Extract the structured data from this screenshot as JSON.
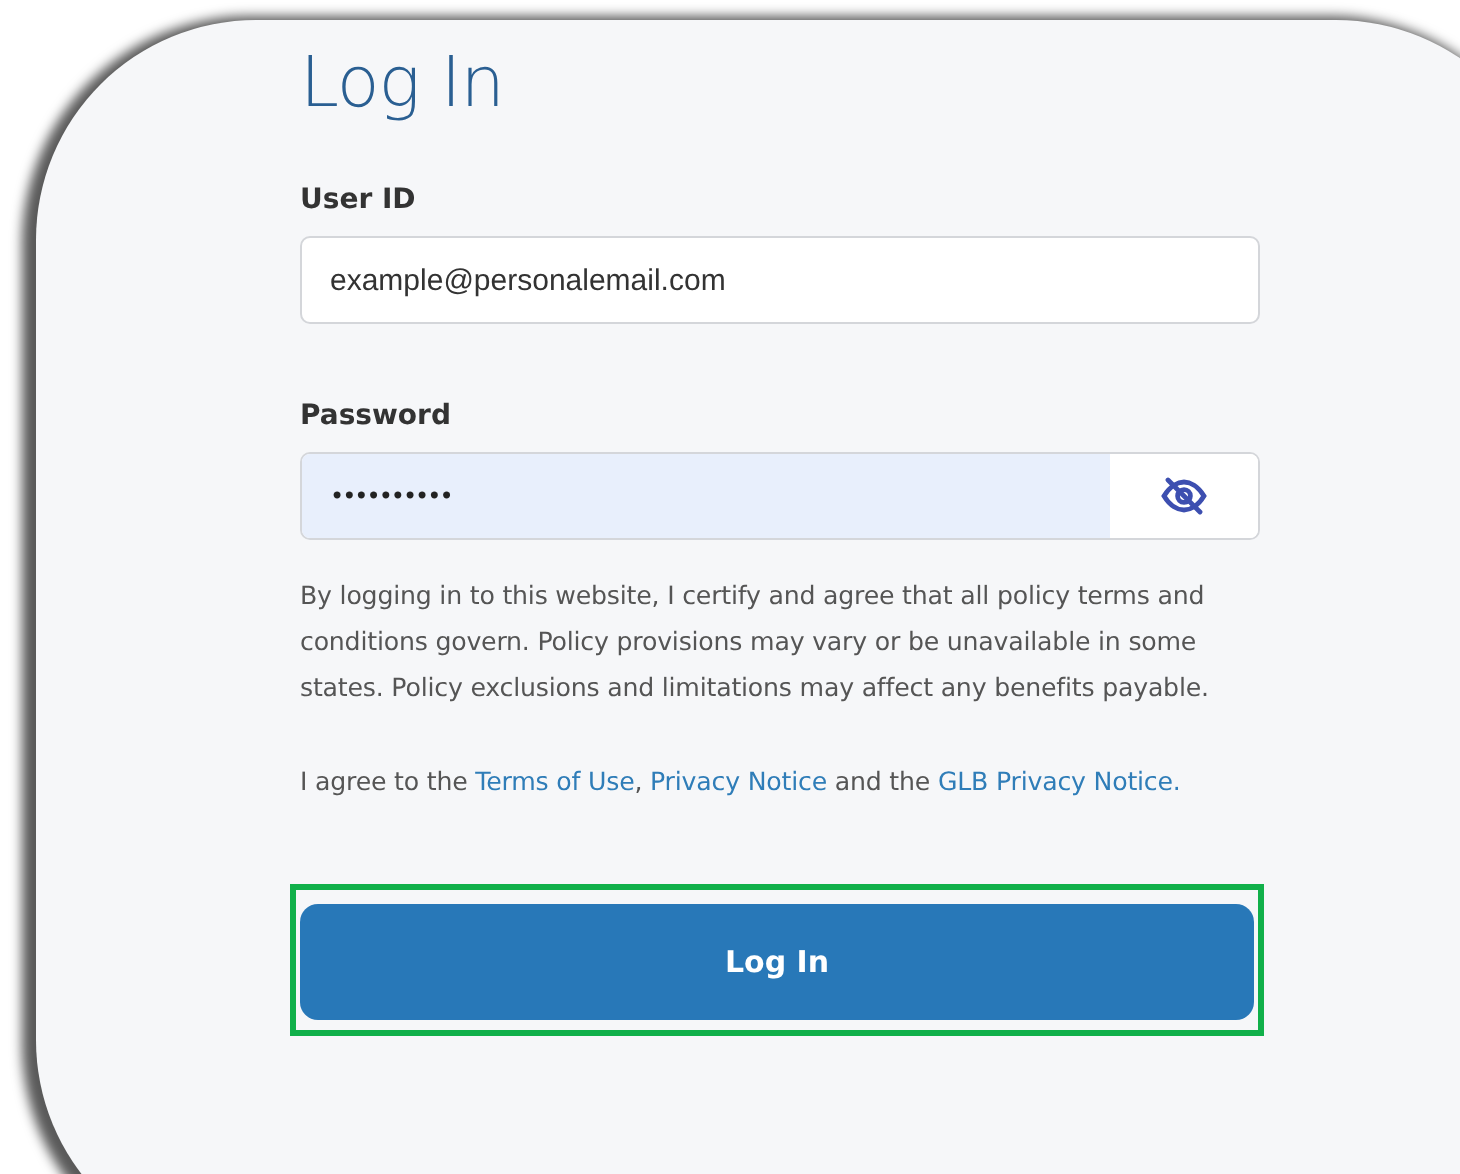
{
  "title": "Log In",
  "fields": [
    {
      "kind": "text",
      "label": "User ID",
      "value": "example@personalemail.com"
    },
    {
      "kind": "password",
      "label": "Password",
      "value": "••••••••••"
    }
  ],
  "disclaimer": "By logging in to this website, I certify and agree that all policy terms and conditions govern. Policy provisions may vary or be unavailable in some states. Policy exclusions and limitations may affect any benefits payable.",
  "agreement": [
    {
      "kind": "text",
      "text": "I agree to the "
    },
    {
      "kind": "link",
      "text": "Terms of Use"
    },
    {
      "kind": "text",
      "text": ", "
    },
    {
      "kind": "link",
      "text": "Privacy Notice"
    },
    {
      "kind": "text",
      "text": " and the "
    },
    {
      "kind": "link",
      "text": "GLB Privacy Notice."
    }
  ],
  "submit": {
    "label": "Log In",
    "highlighted": true
  }
}
